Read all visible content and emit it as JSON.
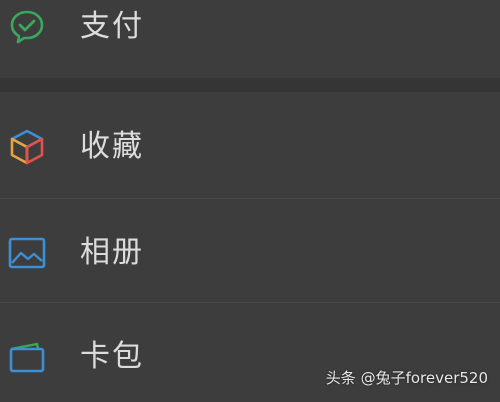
{
  "menu": {
    "items": [
      {
        "label": "支付",
        "icon": "pay-check-icon",
        "color": "#3aa85c"
      },
      {
        "label": "收藏",
        "icon": "cube-icon",
        "color": "#e8a43c"
      },
      {
        "label": "相册",
        "icon": "photo-album-icon",
        "color": "#3d8fd6"
      },
      {
        "label": "卡包",
        "icon": "wallet-icon",
        "color": "#3d8fd6"
      }
    ]
  },
  "watermark": {
    "text": "头条 @兔子forever520"
  },
  "colors": {
    "background": "#3d3d3e",
    "section_gap": "#353536",
    "text": "#dcdcdc"
  }
}
